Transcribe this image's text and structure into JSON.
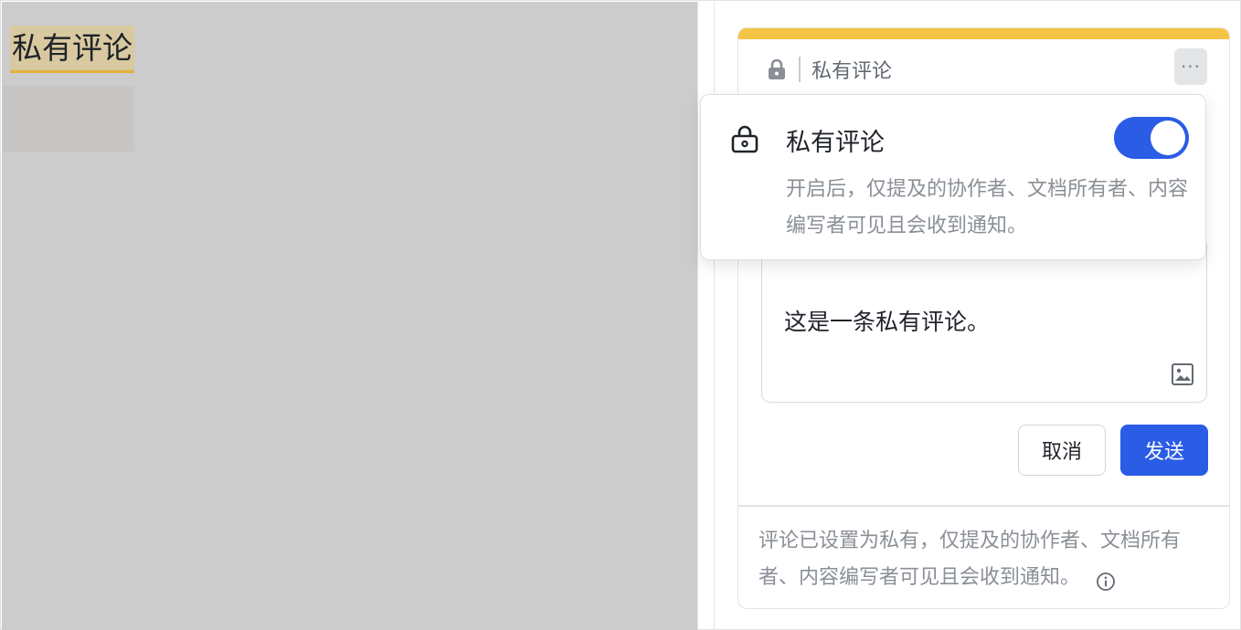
{
  "document": {
    "highlighted_text": "私有评论"
  },
  "card": {
    "header_label": "私有评论",
    "more_button": "···",
    "editor_text": "这是一条私有评论。",
    "cancel_label": "取消",
    "send_label": "发送",
    "footer_note": "评论已设置为私有，仅提及的协作者、文档所有者、内容编写者可见且会收到通知。",
    "accent_color": "#f6c445",
    "primary_color": "#2a5ce6"
  },
  "popup": {
    "title": "私有评论",
    "toggle_on": true,
    "description": "开启后，仅提及的协作者、文档所有者、内容编写者可见且会收到通知。"
  },
  "icons": {
    "header_lock": "lock-icon",
    "popup_lock": "lock-outline-icon",
    "editor_image": "image-icon",
    "footer_info": "info-icon"
  }
}
